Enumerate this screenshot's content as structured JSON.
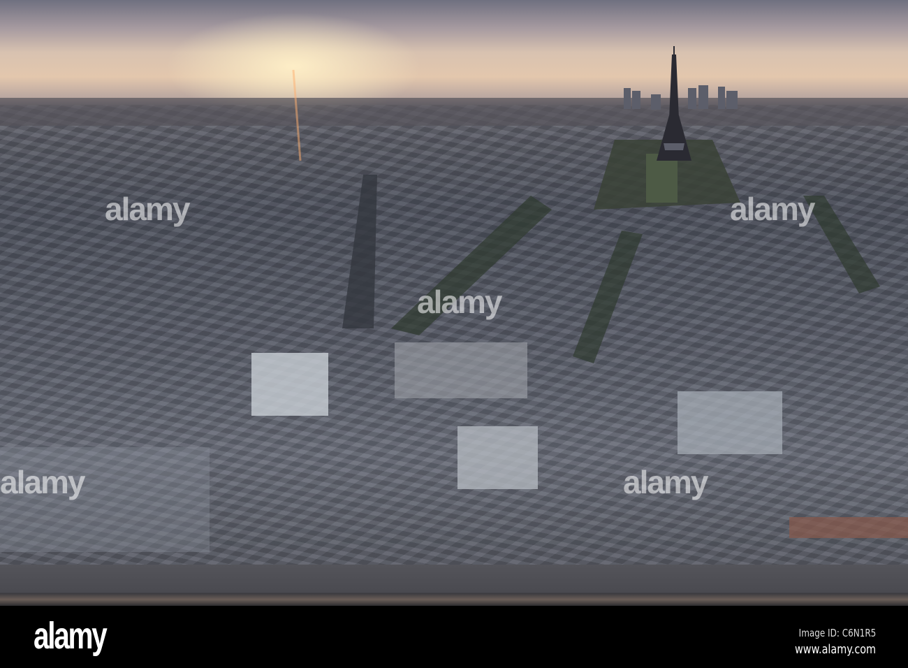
{
  "photo": {
    "subject": "Paris skyline at sunset with Eiffel Tower"
  },
  "watermark": {
    "text": "alamy"
  },
  "footer": {
    "logo": "alamy",
    "image_id": "Image ID: C6N1R5",
    "url": "www.alamy.com"
  }
}
